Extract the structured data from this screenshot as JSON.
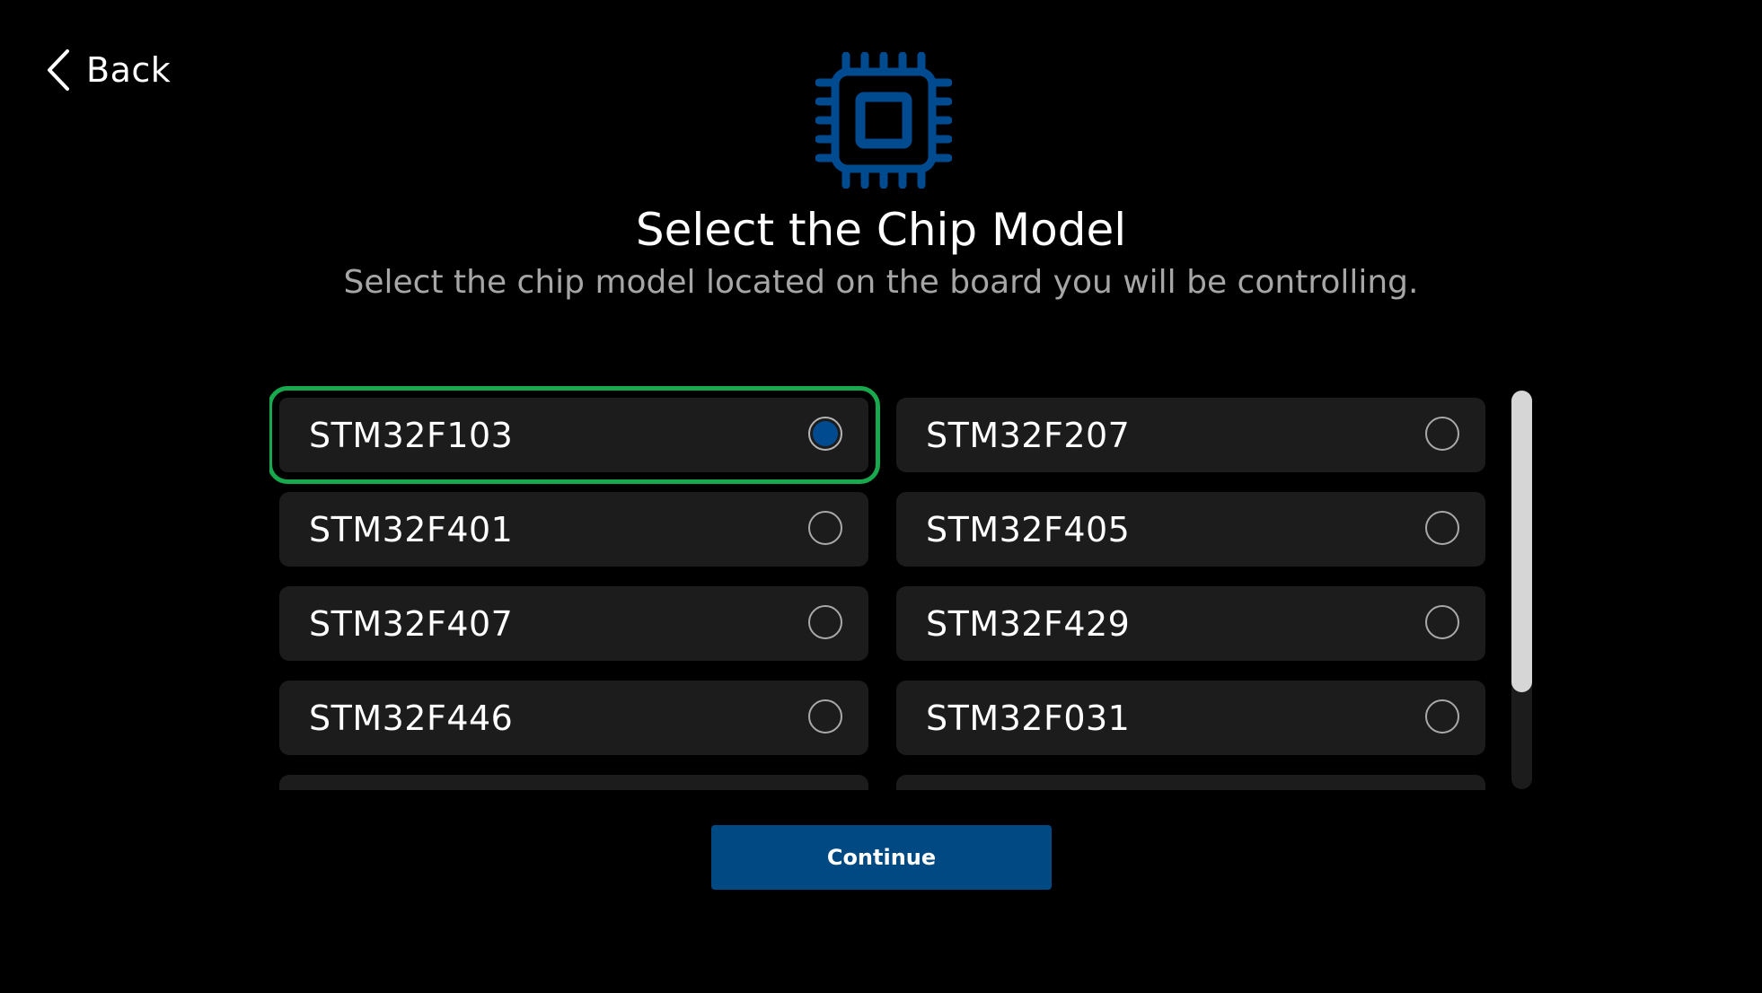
{
  "header": {
    "back_label": "Back",
    "back_icon": "chevron-left-icon"
  },
  "hero": {
    "icon": "chip-icon",
    "title": "Select the Chip Model",
    "subtitle": "Select the chip model located on the board you will be controlling."
  },
  "chip_options": [
    {
      "label": "STM32F103",
      "selected": true
    },
    {
      "label": "STM32F207",
      "selected": false
    },
    {
      "label": "STM32F401",
      "selected": false
    },
    {
      "label": "STM32F405",
      "selected": false
    },
    {
      "label": "STM32F407",
      "selected": false
    },
    {
      "label": "STM32F429",
      "selected": false
    },
    {
      "label": "STM32F446",
      "selected": false
    },
    {
      "label": "STM32F031",
      "selected": false
    },
    {
      "label": "",
      "selected": false
    },
    {
      "label": "",
      "selected": false
    }
  ],
  "footer": {
    "continue_label": "Continue"
  },
  "colors": {
    "background": "#000000",
    "accent_blue": "#004983",
    "radio_fill": "#004a8f",
    "selection_outline": "#18a84d",
    "option_background": "#1c1c1c",
    "subtitle_text": "#a6a6a6"
  }
}
